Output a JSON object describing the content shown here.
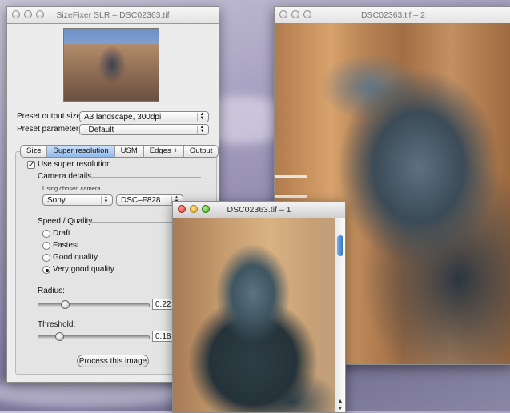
{
  "sizefixer": {
    "title": "SizeFixer SLR – DSC02363.tif",
    "preset_output_label": "Preset output size:",
    "preset_output_value": "A3 landscape, 300dpi",
    "preset_params_label": "Preset parameters:",
    "preset_params_value": "–Default",
    "tabs": [
      "Size",
      "Super resolution",
      "USM",
      "Edges +",
      "Output"
    ],
    "selected_tab": "Super resolution",
    "use_super_resolution_label": "Use super resolution",
    "use_super_resolution_checked": true,
    "camera_details_title": "Camera details",
    "camera_note": "Using chosen camera.",
    "camera_make": "Sony",
    "camera_model": "DSC–F828",
    "speed_quality_title": "Speed / Quality",
    "quality_options": [
      "Draft",
      "Fastest",
      "Good quality",
      "Very good quality"
    ],
    "selected_quality": "Very good quality",
    "radius_label": "Radius:",
    "radius_value": "0.22",
    "threshold_label": "Threshold:",
    "threshold_value": "0.18",
    "process_button": "Process this image"
  },
  "window2": {
    "title": "DSC02363.tif – 2"
  },
  "window1": {
    "title": "DSC02363.tif – 1"
  },
  "icons": [
    "close-light",
    "minimize-light",
    "zoom-light",
    "scroll-arrow-up-icon",
    "scroll-arrow-down-icon",
    "popup-stepper-icon"
  ]
}
